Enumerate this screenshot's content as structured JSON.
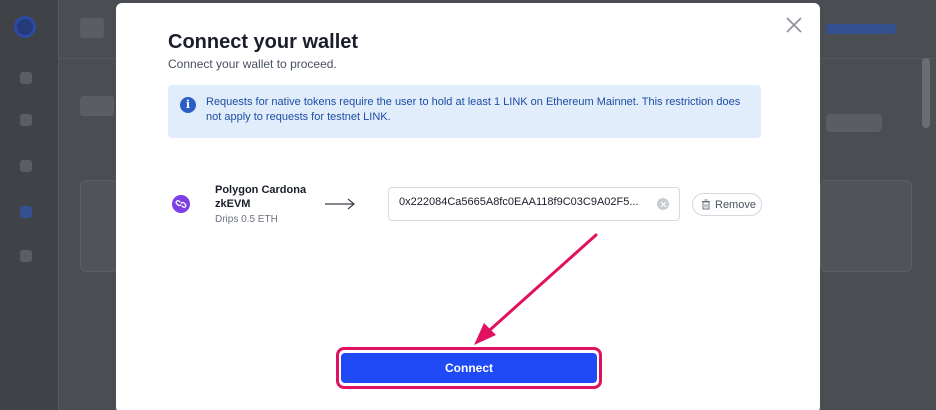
{
  "modal": {
    "title": "Connect your wallet",
    "subtitle": "Connect your wallet to proceed.",
    "info_message": "Requests for native tokens require the user to hold at least 1 LINK on Ethereum Mainnet. This restriction does not apply to requests for testnet LINK.",
    "network": {
      "name": "Polygon Cardona zkEVM",
      "drips": "Drips 0.5 ETH",
      "address_value": "0x222084Ca5665A8fc0EAA118f9C03C9A02F5..."
    },
    "remove_label": "Remove",
    "connect_label": "Connect"
  },
  "colors": {
    "accent": "#1f4af5",
    "annotation": "#e0125f",
    "info_bg": "#e2edfc",
    "network_icon": "#7b3fe4"
  },
  "icons": {
    "close": "close-icon",
    "info": "info-icon",
    "network": "polygon-link-icon",
    "arrow": "arrow-right-icon",
    "clear": "clear-icon",
    "trash": "trash-icon"
  }
}
